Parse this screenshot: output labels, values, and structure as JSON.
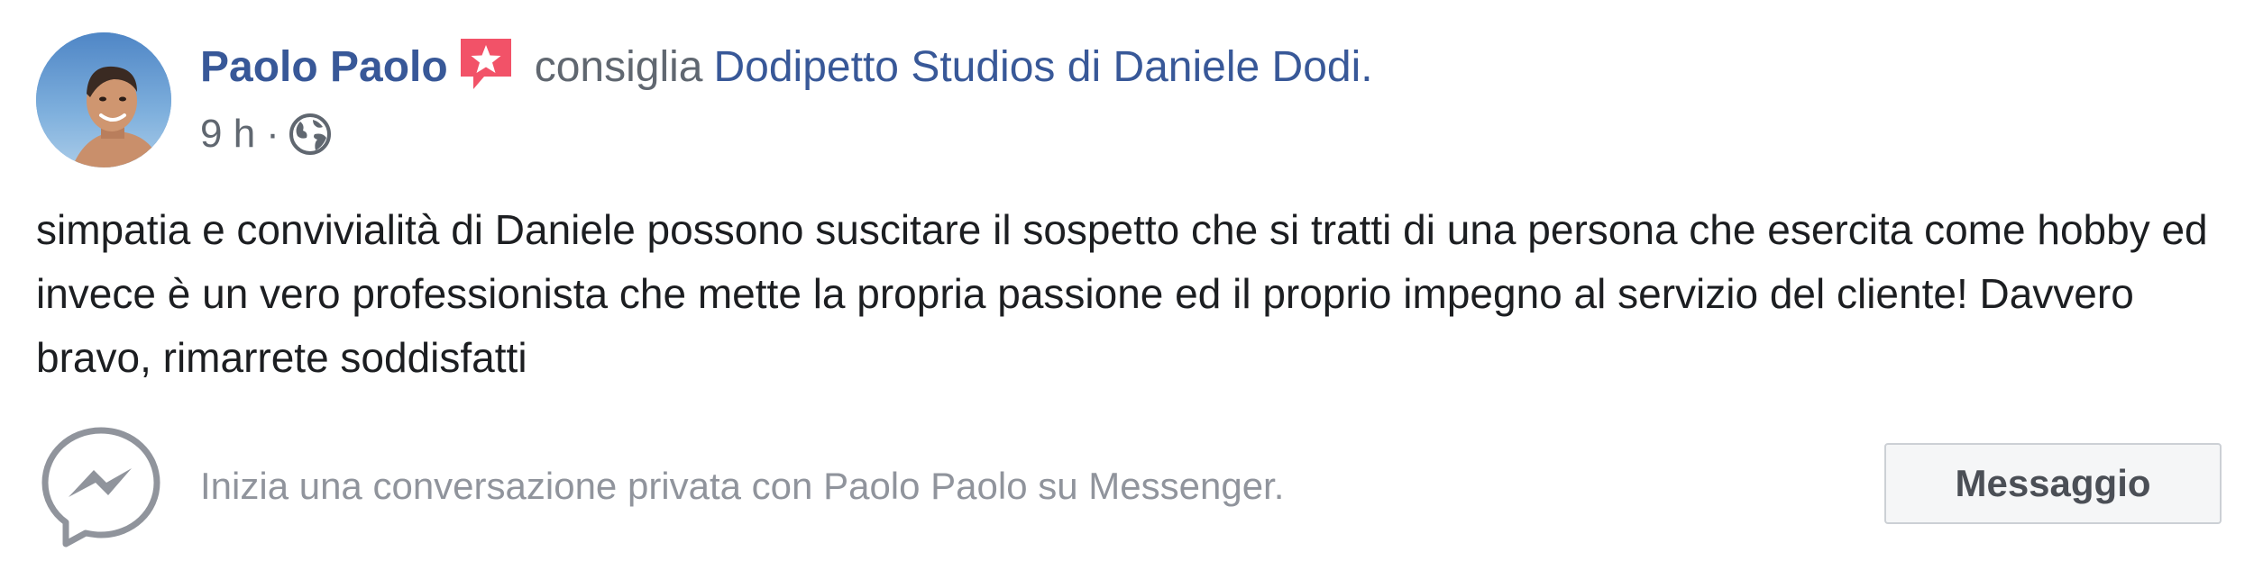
{
  "post": {
    "author": "Paolo Paolo",
    "verb": "consiglia",
    "page_name": "Dodipetto Studios di Daniele Dodi",
    "page_suffix": ".",
    "time": "9 h",
    "separator": "·",
    "privacy_icon": "globe-icon",
    "recommend_icon": "recommendation-star-icon",
    "text": "simpatia e convivialità di Daniele possono suscitare il sospetto che si tratti di una persona che esercita come hobby ed invece è un vero professionista che mette la propria passione ed il proprio impegno al servizio del cliente! Davvero bravo, rimarrete soddisfatti"
  },
  "messenger": {
    "icon": "messenger-icon",
    "prompt": "Inizia una conversazione privata con Paolo Paolo su Messenger.",
    "button_label": "Messaggio"
  },
  "colors": {
    "link": "#385898",
    "secondary_text": "#606770",
    "body_text": "#1c1e21",
    "muted_text": "#90949c",
    "recommend_red": "#f25268",
    "button_bg": "#f5f6f7",
    "button_border": "#ccd0d5"
  }
}
